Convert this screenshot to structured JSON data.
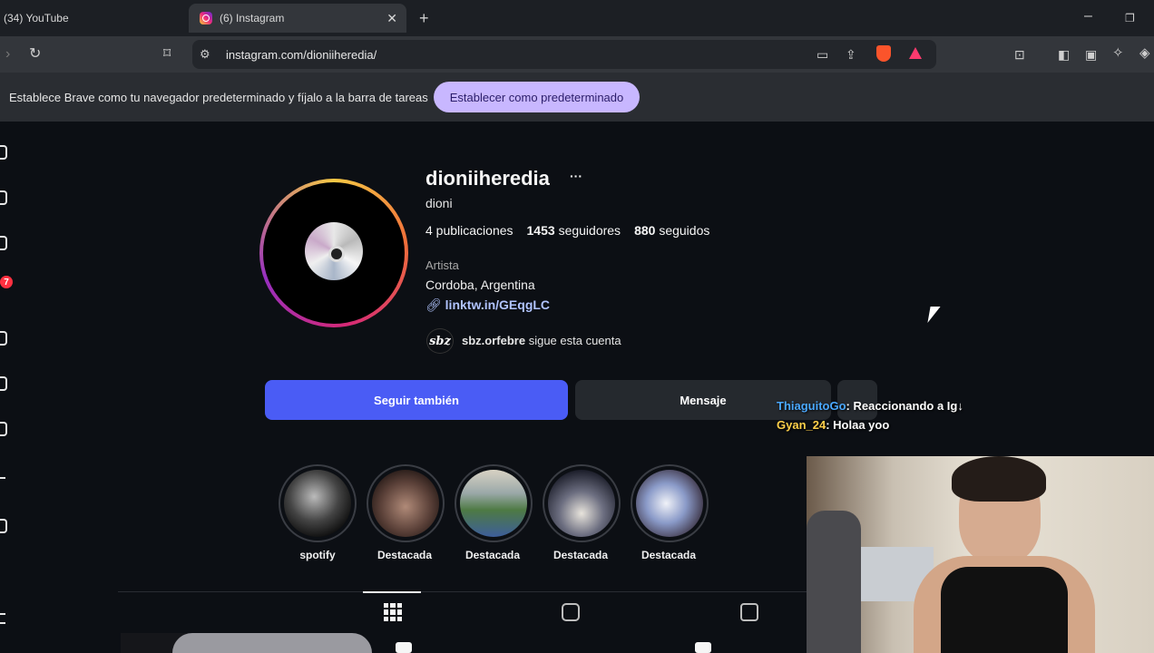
{
  "browser": {
    "tabs": [
      {
        "title": "(34) YouTube",
        "active": false
      },
      {
        "title": "(6) Instagram",
        "active": true
      }
    ],
    "url": "instagram.com/dioniiheredia/",
    "infobar": {
      "message": "Establece Brave como tu navegador predeterminado y fíjalo a la barra de tareas",
      "button": "Establecer como predeterminado"
    }
  },
  "sidebar": {
    "notification_badge": "7"
  },
  "profile": {
    "username": "dioniiheredia",
    "more_icon": "···",
    "full_name": "dioni",
    "stats": {
      "posts": "4 publicaciones",
      "followers_count": "1453",
      "followers_label": "seguidores",
      "following_count": "880",
      "following_label": "seguidos"
    },
    "category": "Artista",
    "location": "Cordoba, Argentina",
    "link": "linktw.in/GEqgLC",
    "followed_by": {
      "logo_text": "sbz",
      "username": "sbz.orfebre",
      "suffix": "sigue esta cuenta"
    },
    "buttons": {
      "follow": "Seguir también",
      "message": "Mensaje"
    },
    "highlights": [
      {
        "label": "spotify"
      },
      {
        "label": "Destacada"
      },
      {
        "label": "Destacada"
      },
      {
        "label": "Destacada"
      },
      {
        "label": "Destacada"
      }
    ]
  },
  "stream_chat": [
    {
      "user": "ThiaguitoGo",
      "message": "Reaccionando a Ig↓"
    },
    {
      "user": "Gyan_24",
      "message": "Holaa yoo"
    }
  ],
  "colors": {
    "follow_button": "#4a5cf5",
    "link": "#b1c4ff",
    "badge": "#ff3040"
  }
}
